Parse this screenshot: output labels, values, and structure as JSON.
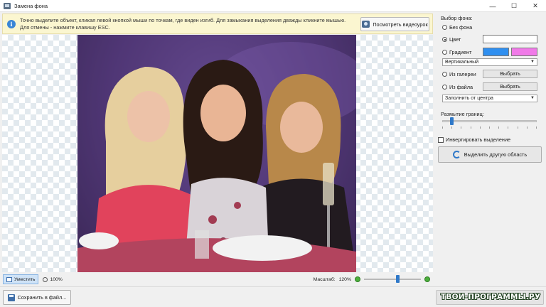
{
  "window": {
    "title": "Замена фона",
    "icon": "picture-icon",
    "buttons": {
      "minimize": "—",
      "maximize": "☐",
      "close": "✕"
    }
  },
  "hint": {
    "icon": "info-icon",
    "text": "Точно выделите объект, кликая левой кнопкой мыши по точкам, где виден изгиб. Для замыкания выделения дважды кликните мышью. Для отмены - нажмите клавишу ESC.",
    "video_button": "Посмотреть видеоурок"
  },
  "canvas": {
    "fit_button": "Уместить",
    "actual_size_button": "100%",
    "zoom_label": "Масштаб:",
    "zoom_value": "120%",
    "zoom_level_fraction": 0.6
  },
  "panel": {
    "background_choice_label": "Выбор фона:",
    "no_background": "Без фона",
    "color": "Цвет",
    "gradient": "Градиент",
    "selected_option": "color",
    "gradient_direction": "Вертикальный",
    "from_gallery": "Из галереи",
    "from_file": "Из файла",
    "choose_button_1": "Выбрать",
    "choose_button_2": "Выбрать",
    "fill_mode": "Заполнить от центра",
    "blur_label": "Размытие границ:",
    "blur_level_fraction": 0.08,
    "invert_selection": "Инвертировать выделение",
    "invert_checked": false,
    "select_other_area": "Выделить другую область",
    "colors": {
      "solid": "#ffffff",
      "gradient_start": "#2f8ff0",
      "gradient_end": "#f07ae8"
    }
  },
  "footer": {
    "save_button": "Сохранить в файл...",
    "watermark": "ТВОИ-ПРОГРАММЫ.РУ"
  }
}
